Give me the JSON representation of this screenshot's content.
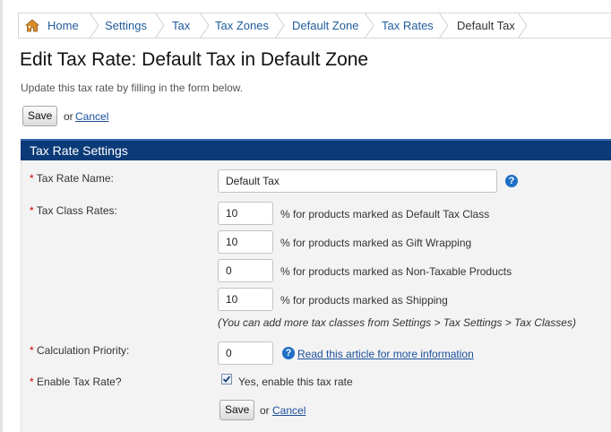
{
  "breadcrumb": {
    "items": [
      "Home",
      "Settings",
      "Tax",
      "Tax Zones",
      "Default Zone",
      "Tax Rates",
      "Default Tax"
    ]
  },
  "page": {
    "title": "Edit Tax Rate: Default Tax in Default Zone",
    "intro": "Update this tax rate by filling in the form below.",
    "save_label": "Save",
    "or_text": "or",
    "cancel_label": "Cancel"
  },
  "panel": {
    "title": "Tax Rate Settings",
    "required_marker": "*",
    "fields": {
      "name_label": "Tax Rate Name:",
      "name_value": "Default Tax",
      "class_rates_label": "Tax Class Rates:",
      "rates": [
        {
          "value": "10",
          "text": "% for products marked as Default Tax Class"
        },
        {
          "value": "10",
          "text": "% for products marked as Gift Wrapping"
        },
        {
          "value": "0",
          "text": "% for products marked as Non-Taxable Products"
        },
        {
          "value": "10",
          "text": "% for products marked as Shipping"
        }
      ],
      "rates_note": "(You can add more tax classes from Settings > Tax Settings > Tax Classes)",
      "priority_label": "Calculation Priority:",
      "priority_value": "0",
      "priority_help_link": "Read this article for more information",
      "enable_label": "Enable Tax Rate?",
      "enable_checkbox_label": "Yes, enable this tax rate",
      "enable_checked": true
    },
    "help_glyph": "?",
    "save_label": "Save",
    "or_text": "or",
    "cancel_label": "Cancel"
  },
  "colors": {
    "link": "#1a4f9c",
    "panel_header": "#0b3a78",
    "panel_body": "#f3f3f3",
    "help_icon": "#1f6fc6"
  }
}
